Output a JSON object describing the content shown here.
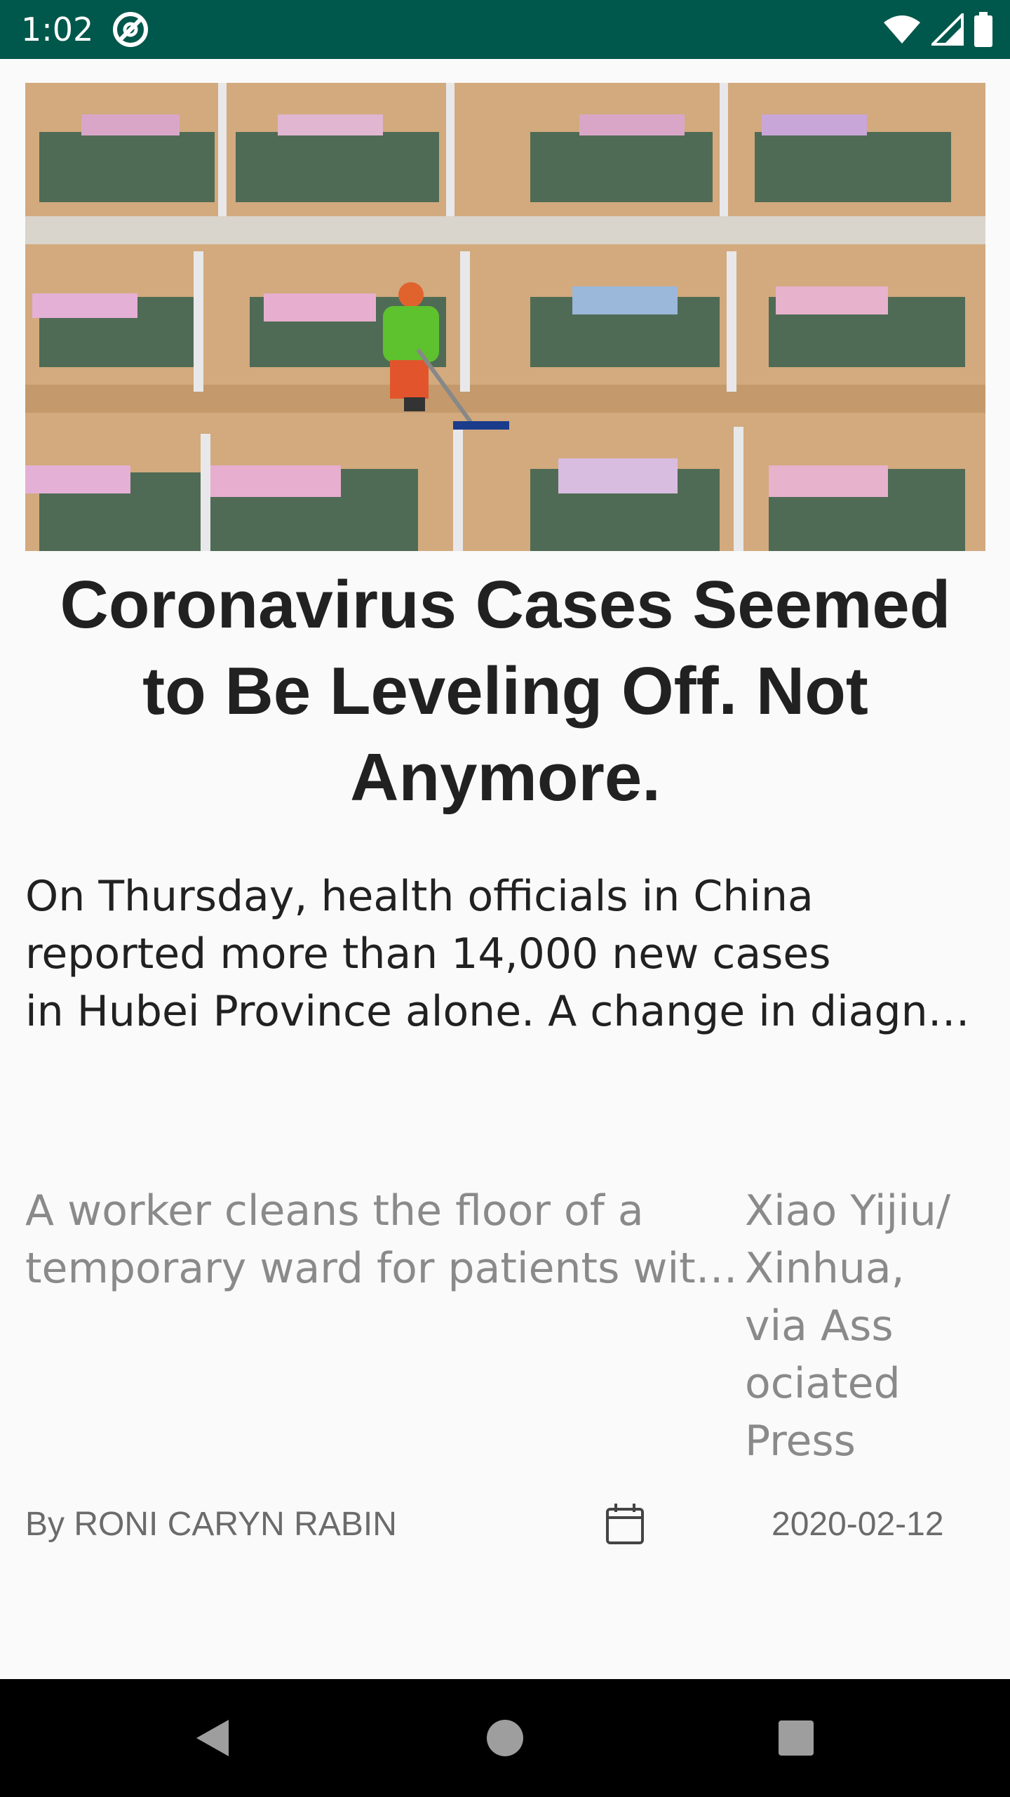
{
  "status_bar": {
    "time": "1:02",
    "icons": [
      "app-notification-icon",
      "wifi-icon",
      "signal-icon",
      "battery-icon"
    ]
  },
  "article": {
    "image_alt": "Temporary hospital ward with rows of beds and a worker cleaning the floor",
    "headline_lines": [
      "Coronavirus Cases Seemed",
      "to Be Leveling Off. Not",
      "Anymore."
    ],
    "summary_lines": [
      "On Thursday, health officials in China",
      "reported more than 14,000 new cases",
      "in Hubei Province alone. A change in diagn…"
    ],
    "caption_lines": [
      "A worker cleans the floor of a",
      "temporary ward for patients wit…"
    ],
    "credit_lines": [
      "Xiao Yijiu/",
      "Xinhua,",
      "via Ass",
      "ociated",
      "Press"
    ],
    "byline": "By RONI CARYN RABIN",
    "date": "2020-02-12"
  },
  "nav_bar": {
    "buttons": [
      "back-icon",
      "home-icon",
      "recents-icon"
    ]
  },
  "colors": {
    "status_bar_bg": "#00574b",
    "background": "#fafafa",
    "headline": "#212121",
    "caption": "#8a8a8a",
    "byline": "#6b6b6b",
    "nav_bar_bg": "#000000"
  }
}
